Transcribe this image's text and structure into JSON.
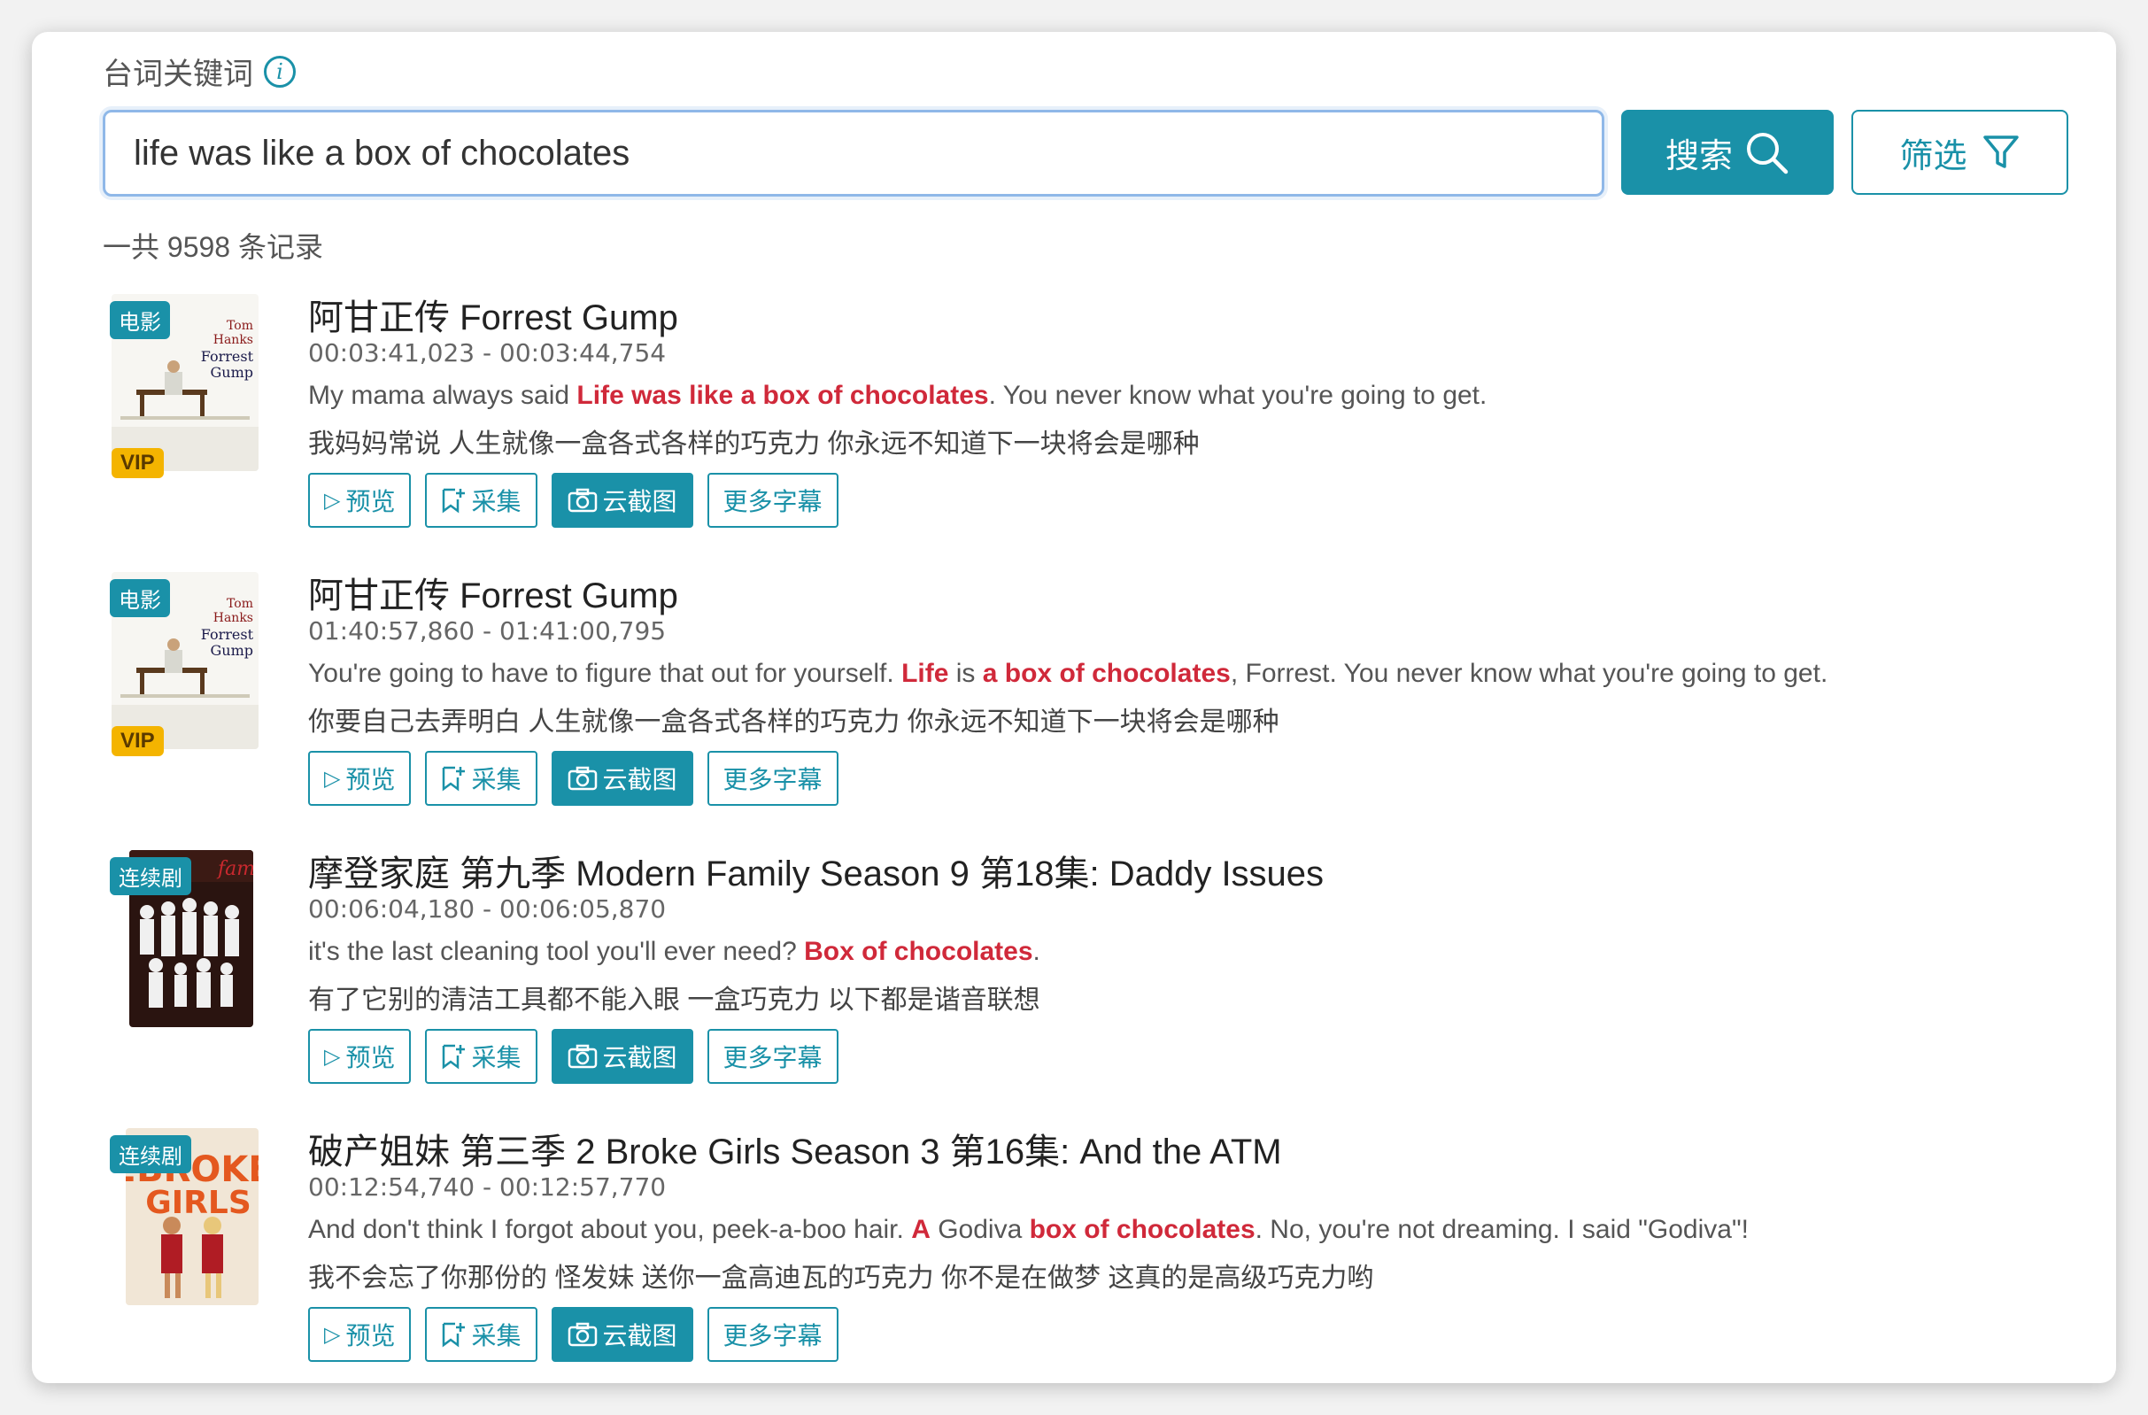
{
  "search": {
    "label": "台词关键词",
    "value": "life was like a box of chocolates",
    "search_button": "搜索",
    "filter_button": "筛选"
  },
  "summary": {
    "count_text": "一共 9598 条记录"
  },
  "colors": {
    "accent": "#1a91a8",
    "highlight": "#d0293a",
    "vip": "#f4b400"
  },
  "results": [
    {
      "tag": "电影",
      "vip": "VIP",
      "poster": "forrest-gump-poster",
      "title": "阿甘正传 Forrest Gump",
      "timecode": "00:03:41,023 - 00:03:44,754",
      "en_parts": [
        {
          "t": "My mama always said  ",
          "hl": false
        },
        {
          "t": "Life was like a box of chocolates",
          "hl": true
        },
        {
          "t": ". You never know what you're going to get.",
          "hl": false
        }
      ],
      "zh": "我妈妈常说  人生就像一盒各式各样的巧克力 你永远不知道下一块将会是哪种"
    },
    {
      "tag": "电影",
      "vip": "VIP",
      "poster": "forrest-gump-poster",
      "title": "阿甘正传 Forrest Gump",
      "timecode": "01:40:57,860 - 01:41:00,795",
      "en_parts": [
        {
          "t": "You're going to have to figure that out for yourself.  ",
          "hl": false
        },
        {
          "t": "Life",
          "hl": true
        },
        {
          "t": " is ",
          "hl": false
        },
        {
          "t": "a box of chocolates",
          "hl": true
        },
        {
          "t": ", Forrest. You never know what you're going to get.",
          "hl": false
        }
      ],
      "zh": "你要自己去弄明白  人生就像一盒各式各样的巧克力 你永远不知道下一块将会是哪种"
    },
    {
      "tag": "连续剧",
      "vip": "",
      "poster": "modern-family-poster",
      "title": "摩登家庭 第九季 Modern Family Season 9 第18集: Daddy Issues",
      "timecode": "00:06:04,180 - 00:06:05,870",
      "en_parts": [
        {
          "t": "it's the last cleaning tool you'll ever need?  ",
          "hl": false
        },
        {
          "t": "Box of chocolates",
          "hl": true
        },
        {
          "t": ".",
          "hl": false
        }
      ],
      "zh": "有了它别的清洁工具都不能入眼  一盒巧克力 以下都是谐音联想"
    },
    {
      "tag": "连续剧",
      "vip": "",
      "poster": "2-broke-girls-poster",
      "title": "破产姐妹 第三季 2 Broke Girls Season 3 第16集: And the ATM",
      "timecode": "00:12:54,740 - 00:12:57,770",
      "en_parts": [
        {
          "t": "And don't think I forgot about you, peek-a-boo hair.  ",
          "hl": false
        },
        {
          "t": "A",
          "hl": true
        },
        {
          "t": " Godiva ",
          "hl": false
        },
        {
          "t": "box of chocolates",
          "hl": true
        },
        {
          "t": ". No, you're not dreaming. I said \"Godiva\"!",
          "hl": false
        }
      ],
      "zh": "我不会忘了你那份的 怪发妹  送你一盒高迪瓦的巧克力 你不是在做梦 这真的是高级巧克力哟"
    }
  ],
  "actions": {
    "preview": "预览",
    "collect": "采集",
    "screenshot": "云截图",
    "more_subs": "更多字幕"
  }
}
